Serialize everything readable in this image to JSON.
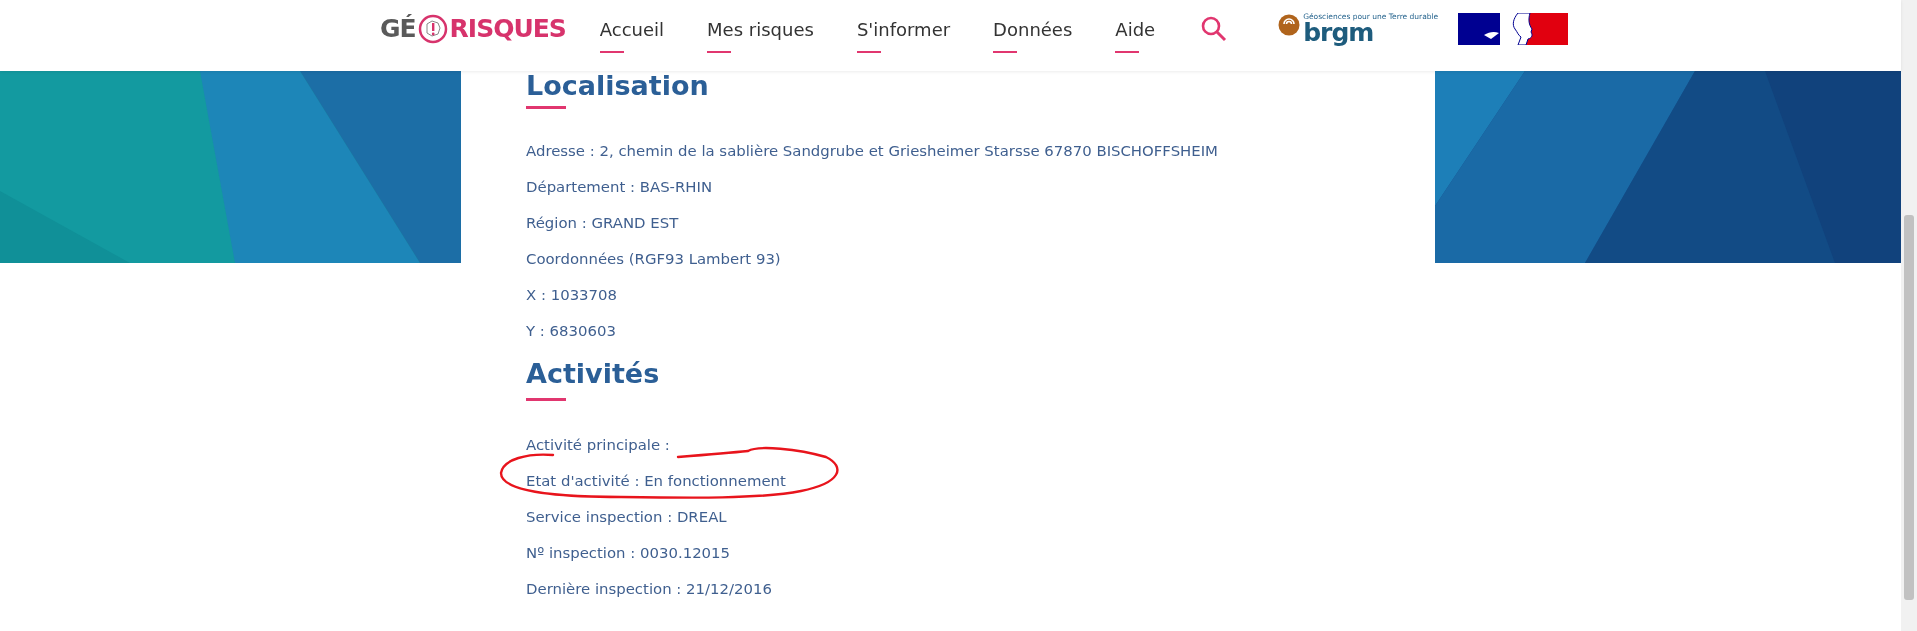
{
  "header": {
    "logo": {
      "left": "GÉ",
      "right": "RISQUES"
    },
    "nav": [
      {
        "label": "Accueil"
      },
      {
        "label": "Mes risques"
      },
      {
        "label": "S'informer"
      },
      {
        "label": "Données"
      },
      {
        "label": "Aide"
      }
    ],
    "partner": {
      "tagline": "Géosciences pour une Terre durable",
      "name": "brgm"
    }
  },
  "sections": [
    {
      "title": "Localisation",
      "rows": [
        {
          "text": "Adresse : 2, chemin de la sablière Sandgrube et Griesheimer Starsse 67870 BISCHOFFSHEIM",
          "circled": false
        },
        {
          "text": "Département : BAS-RHIN",
          "circled": false
        },
        {
          "text": "Région : GRAND EST",
          "circled": false
        },
        {
          "text": "Coordonnées (RGF93 Lambert 93)",
          "circled": false
        },
        {
          "text": "X : 1033708",
          "circled": false
        },
        {
          "text": "Y : 6830603",
          "circled": false
        }
      ]
    },
    {
      "title": "Activités",
      "rows": [
        {
          "text": "Activité principale :",
          "circled": false
        },
        {
          "text": "Etat d'activité : En fonctionnement",
          "circled": true
        },
        {
          "text": "Service inspection : DREAL",
          "circled": false
        },
        {
          "text": "Nº inspection : 0030.12015",
          "circled": false
        },
        {
          "text": "Dernière inspection : 21/12/2016",
          "circled": false
        }
      ]
    }
  ]
}
